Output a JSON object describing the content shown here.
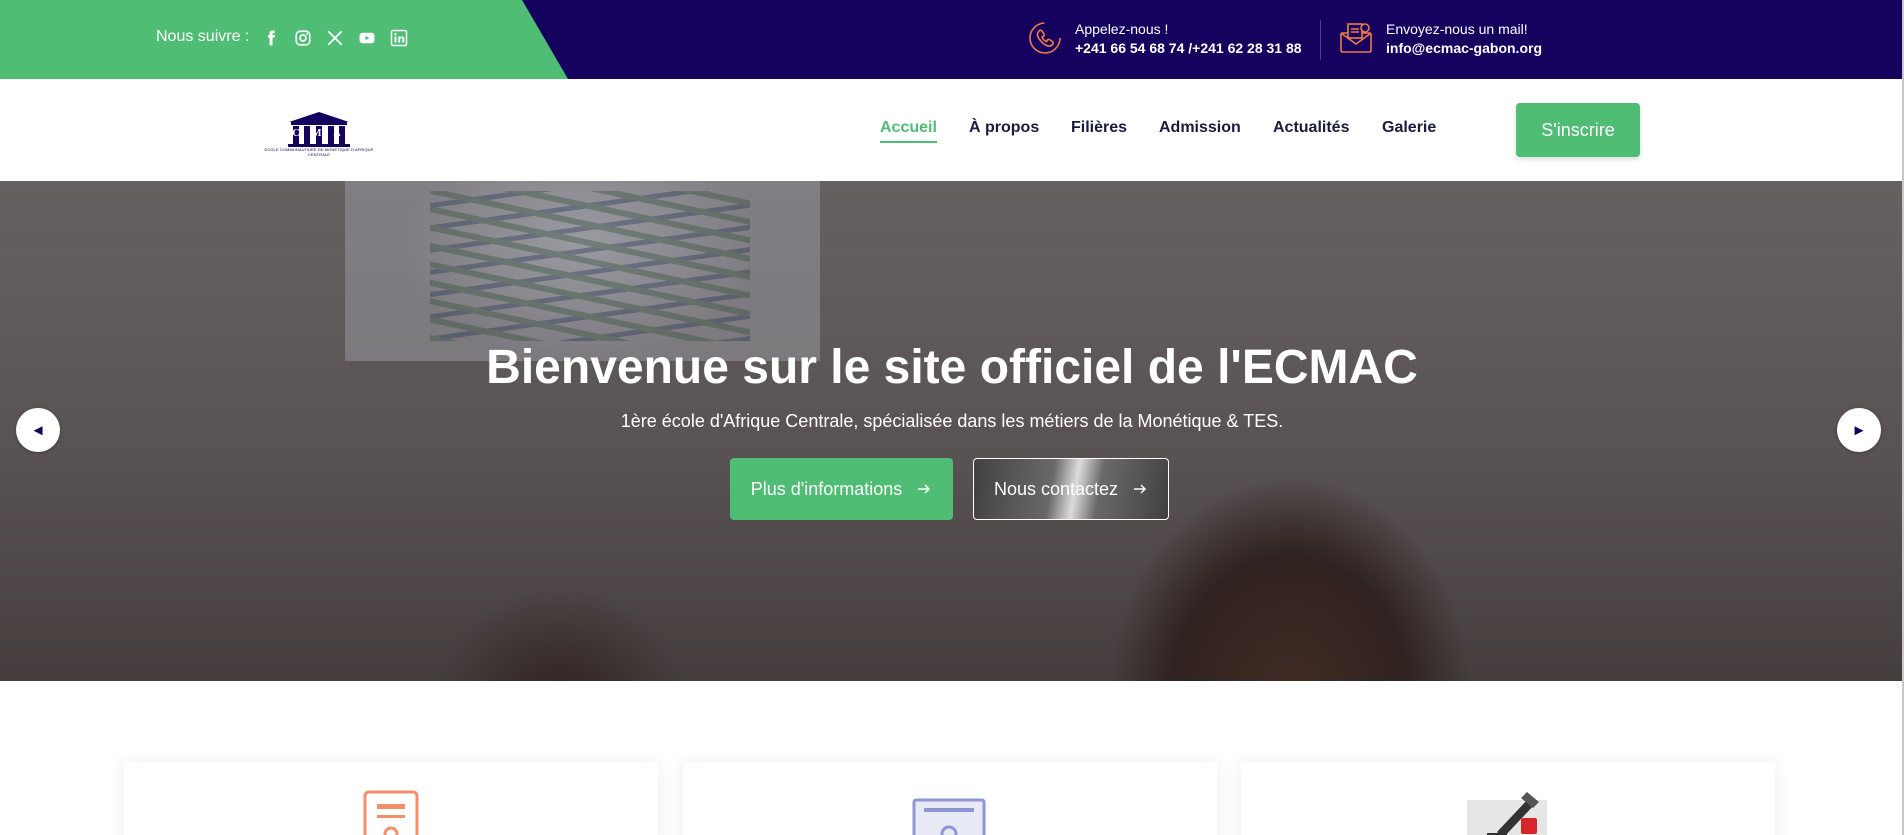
{
  "topbar": {
    "follow_label": "Nous suivre :",
    "social_icons": [
      "facebook-icon",
      "instagram-icon",
      "x-icon",
      "youtube-icon",
      "linkedin-icon"
    ],
    "phone": {
      "label": "Appelez-nous !",
      "value": "+241 66 54 68 74 /+241 62 28 31 88"
    },
    "email": {
      "label": "Envoyez-nous un mail!",
      "value": "info@ecmac-gabon.org"
    },
    "colors": {
      "green": "#4fbd74",
      "navy": "#14025e",
      "icon_accent": "#f07a4b"
    }
  },
  "header": {
    "logo": {
      "letters": "E C M A C",
      "subtitle": "ECOLE COMMUNAUTAIRE DE MONÉTIQUE D'AFRIQUE CENTRALE"
    },
    "nav": [
      {
        "label": "Accueil",
        "active": true
      },
      {
        "label": "À propos",
        "active": false
      },
      {
        "label": "Filières",
        "active": false
      },
      {
        "label": "Admission",
        "active": false
      },
      {
        "label": "Actualités",
        "active": false
      },
      {
        "label": "Galerie",
        "active": false
      }
    ],
    "cta": "S'inscrire"
  },
  "hero": {
    "title": "Bienvenue sur le site officiel de l'ECMAC",
    "subtitle": "1ère école d'Afrique Centrale, spécialisée dans les métiers de la Monétique & TES.",
    "primary_button": "Plus d'informations",
    "secondary_button": "Nous contactez",
    "prev_arrow": "◄",
    "next_arrow": "►"
  },
  "cards": [
    {
      "icon": "document-icon"
    },
    {
      "icon": "certificate-icon"
    },
    {
      "icon": "pen-signature-icon"
    }
  ]
}
